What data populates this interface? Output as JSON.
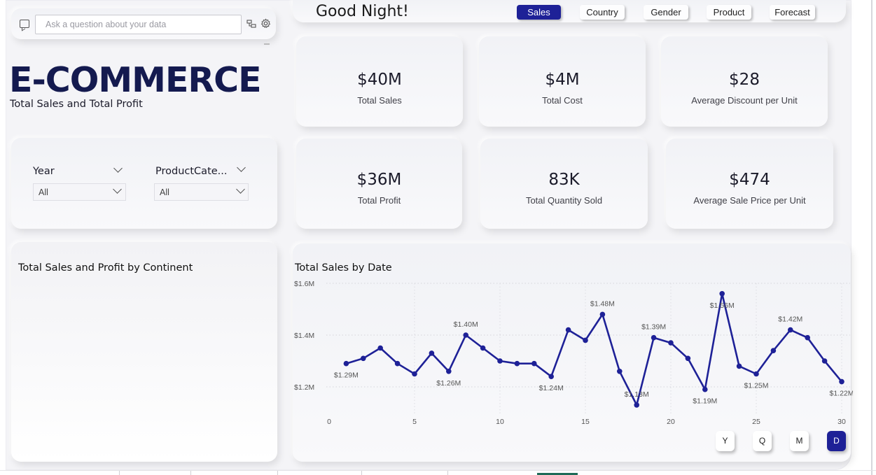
{
  "qa": {
    "placeholder": "Ask a question about your data"
  },
  "header": {
    "title": "E-COMMERCE",
    "subtitle": "Total Sales and Total Profit",
    "greeting": "Good Night!"
  },
  "nav": [
    {
      "label": "Sales",
      "active": true
    },
    {
      "label": "Country",
      "active": false
    },
    {
      "label": "Gender",
      "active": false
    },
    {
      "label": "Product",
      "active": false
    },
    {
      "label": "Forecast",
      "active": false
    }
  ],
  "kpis": [
    {
      "value": "$40M",
      "label": "Total Sales"
    },
    {
      "value": "$4M",
      "label": "Total Cost"
    },
    {
      "value": "$28",
      "label": "Average Discount per Unit"
    },
    {
      "value": "$36M",
      "label": "Total Profit"
    },
    {
      "value": "83K",
      "label": "Total Quantity Sold"
    },
    {
      "value": "$474",
      "label": "Average Sale Price per Unit"
    }
  ],
  "filters": [
    {
      "label": "Year",
      "value": "All"
    },
    {
      "label": "ProductCate...",
      "value": "All"
    }
  ],
  "continent_card": {
    "title": "Total Sales and Profit by Continent"
  },
  "time_buttons": [
    {
      "label": "Y",
      "active": false
    },
    {
      "label": "Q",
      "active": false
    },
    {
      "label": "M",
      "active": false
    },
    {
      "label": "D",
      "active": true
    }
  ],
  "colors": {
    "accent": "#1e2197",
    "title": "#141a4f",
    "line": "#1e2197"
  },
  "chart_data": {
    "type": "line",
    "title": "Total Sales by Date",
    "xlabel": "",
    "ylabel": "",
    "x_ticks": [
      0,
      5,
      10,
      15,
      20,
      25,
      30
    ],
    "y_ticks": [
      "$1.2M",
      "$1.4M",
      "$1.6M"
    ],
    "xlim": [
      0,
      30
    ],
    "ylim": [
      1.2,
      1.6
    ],
    "grid": true,
    "series": [
      {
        "x": [
          1,
          2,
          3,
          4,
          5,
          6,
          7,
          8,
          9,
          10,
          11,
          12,
          13,
          14,
          15,
          16,
          17,
          18,
          19,
          20,
          21,
          22,
          23,
          24,
          25,
          26,
          27,
          28,
          29,
          30
        ],
        "values": [
          1.29,
          1.31,
          1.35,
          1.29,
          1.25,
          1.33,
          1.26,
          1.4,
          1.35,
          1.3,
          1.29,
          1.29,
          1.24,
          1.42,
          1.38,
          1.48,
          1.26,
          1.13,
          1.39,
          1.37,
          1.31,
          1.19,
          1.56,
          1.28,
          1.25,
          1.34,
          1.42,
          1.39,
          1.3,
          1.22
        ]
      }
    ],
    "data_labels": [
      {
        "x": 1,
        "text": "$1.29M",
        "pos": "below"
      },
      {
        "x": 7,
        "text": "$1.26M",
        "pos": "below"
      },
      {
        "x": 8,
        "text": "$1.40M",
        "pos": "above"
      },
      {
        "x": 13,
        "text": "$1.24M",
        "pos": "below"
      },
      {
        "x": 16,
        "text": "$1.48M",
        "pos": "above"
      },
      {
        "x": 18,
        "text": "$1.13M",
        "pos": "above"
      },
      {
        "x": 19,
        "text": "$1.39M",
        "pos": "above"
      },
      {
        "x": 22,
        "text": "$1.19M",
        "pos": "below"
      },
      {
        "x": 23,
        "text": "$1.56M",
        "pos": "below"
      },
      {
        "x": 25,
        "text": "$1.25M",
        "pos": "below"
      },
      {
        "x": 27,
        "text": "$1.42M",
        "pos": "above"
      },
      {
        "x": 30,
        "text": "$1.22M",
        "pos": "below"
      }
    ]
  }
}
